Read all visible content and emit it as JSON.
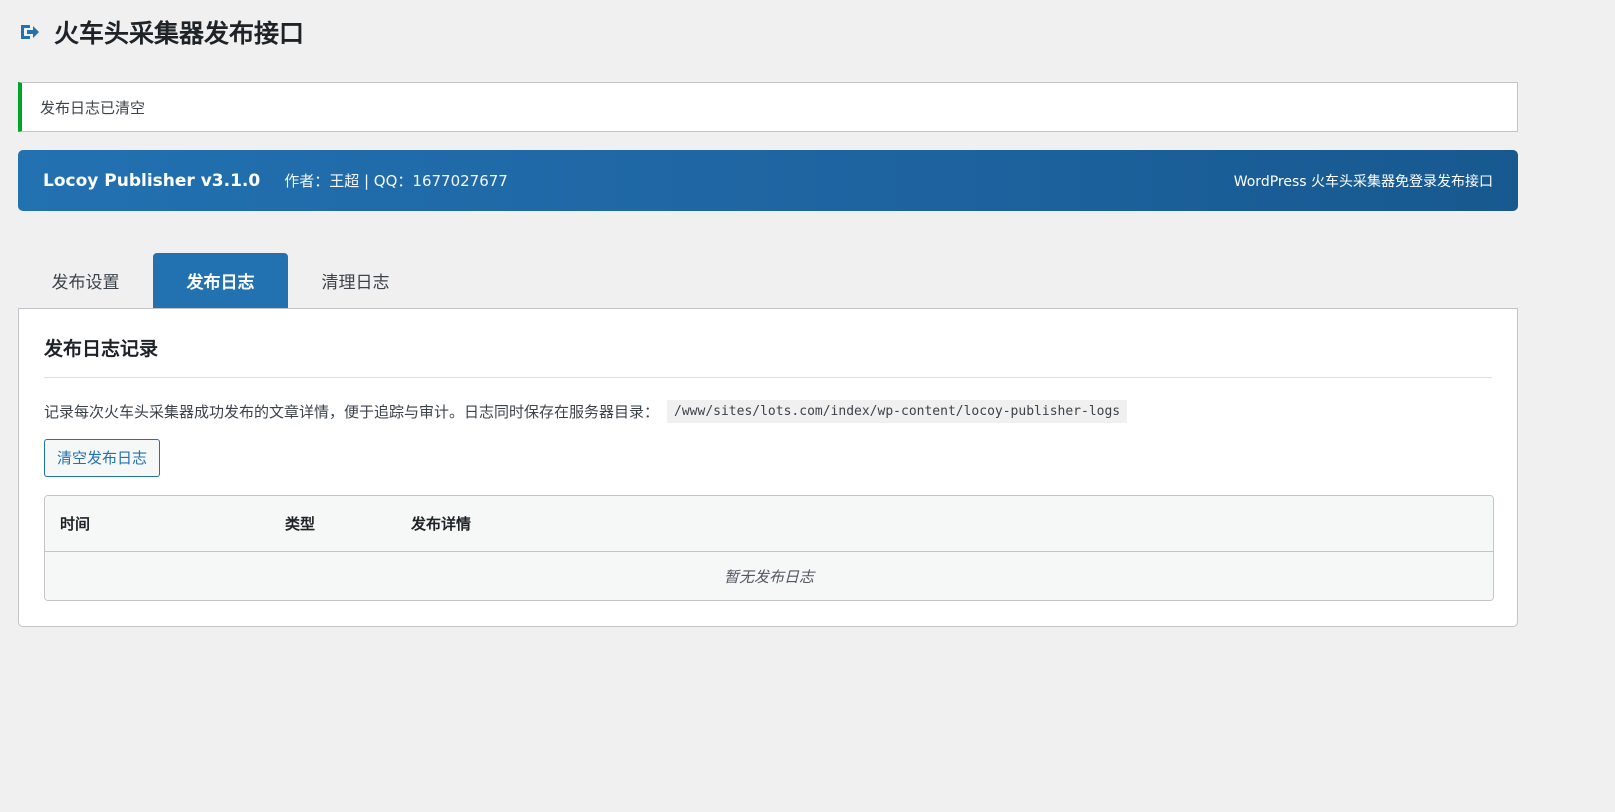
{
  "header": {
    "icon": "exit-arrow-icon",
    "title": "火车头采集器发布接口"
  },
  "notice": {
    "text": "发布日志已清空",
    "status_color": "#00a32a"
  },
  "banner": {
    "name": "Locoy Publisher v3.1.0",
    "author": "作者：王超 | QQ：1677027677",
    "tagline": "WordPress 火车头采集器免登录发布接口",
    "color": "#2271b1"
  },
  "tabs": [
    {
      "label": "发布设置",
      "active": false
    },
    {
      "label": "发布日志",
      "active": true
    },
    {
      "label": "清理日志",
      "active": false
    }
  ],
  "panel": {
    "title": "发布日志记录",
    "description": "记录每次火车头采集器成功发布的文章详情，便于追踪与审计。日志同时保存在服务器目录：",
    "path": "/www/sites/lots.com/index/wp-content/locoy-publisher-logs",
    "clear_button": "清空发布日志",
    "table": {
      "columns": [
        "时间",
        "类型",
        "发布详情"
      ],
      "empty_text": "暂无发布日志"
    }
  }
}
